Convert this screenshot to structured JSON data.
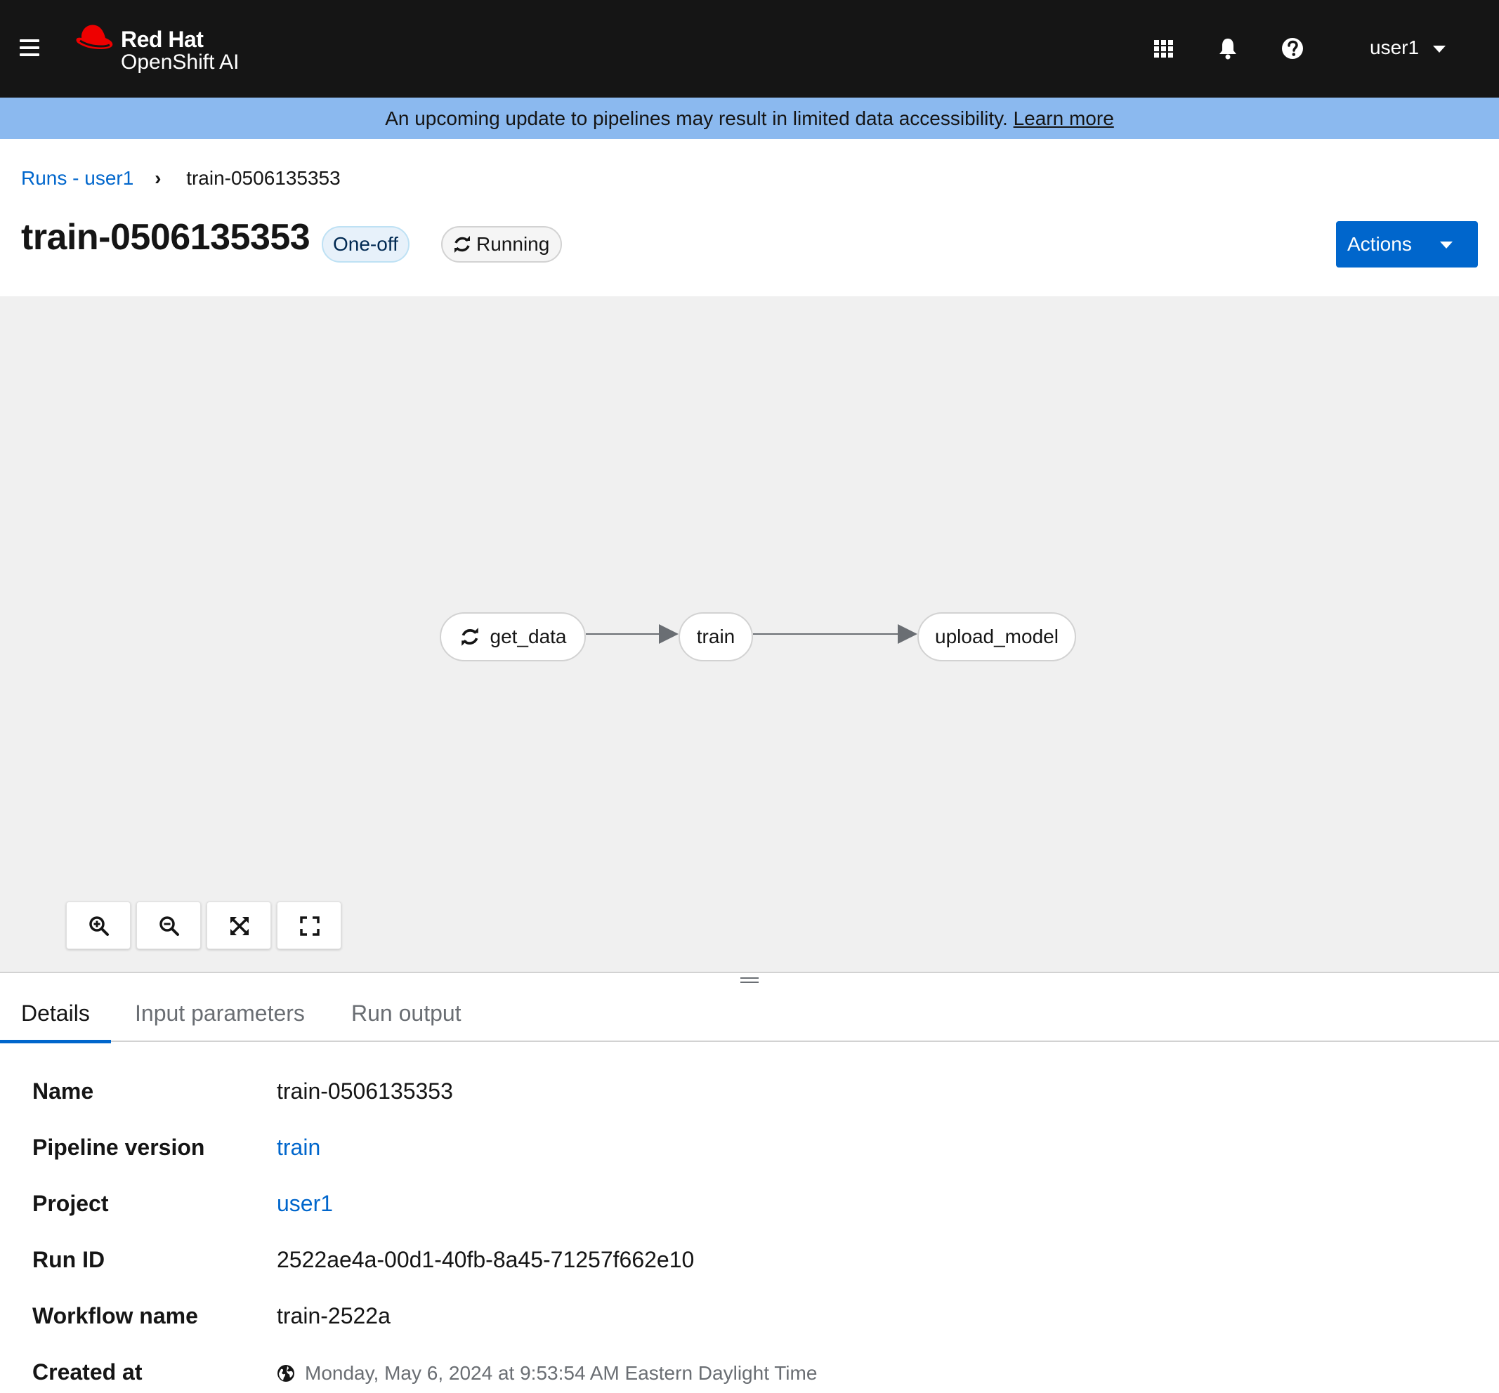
{
  "masthead": {
    "brand_line1": "Red Hat",
    "brand_line2": "OpenShift AI",
    "user": "user1"
  },
  "banner": {
    "text": "An upcoming update to pipelines may result in limited data accessibility. ",
    "link": "Learn more"
  },
  "breadcrumb": {
    "parent": "Runs - user1",
    "current": "train-0506135353"
  },
  "header": {
    "title": "train-0506135353",
    "type_label": "One-off",
    "status_label": "Running",
    "actions_label": "Actions"
  },
  "graph": {
    "nodes": [
      {
        "label": "get_data",
        "status": "running"
      },
      {
        "label": "train"
      },
      {
        "label": "upload_model"
      }
    ]
  },
  "tabs": [
    {
      "label": "Details",
      "active": true
    },
    {
      "label": "Input parameters"
    },
    {
      "label": "Run output"
    }
  ],
  "details": [
    {
      "label": "Name",
      "value": "train-0506135353"
    },
    {
      "label": "Pipeline version",
      "value": "train"
    },
    {
      "label": "Project",
      "value": "user1"
    },
    {
      "label": "Run ID",
      "value": "2522ae4a-00d1-40fb-8a45-71257f662e10"
    },
    {
      "label": "Workflow name",
      "value": "train-2522a"
    },
    {
      "label": "Created at",
      "value": "Monday, May 6, 2024 at 9:53:54 AM Eastern Daylight Time"
    }
  ],
  "colors": {
    "masthead_bg": "#151515",
    "banner_bg": "#8bb9ef",
    "link": "#0066cc",
    "canvas_bg": "#f0f0f0"
  }
}
